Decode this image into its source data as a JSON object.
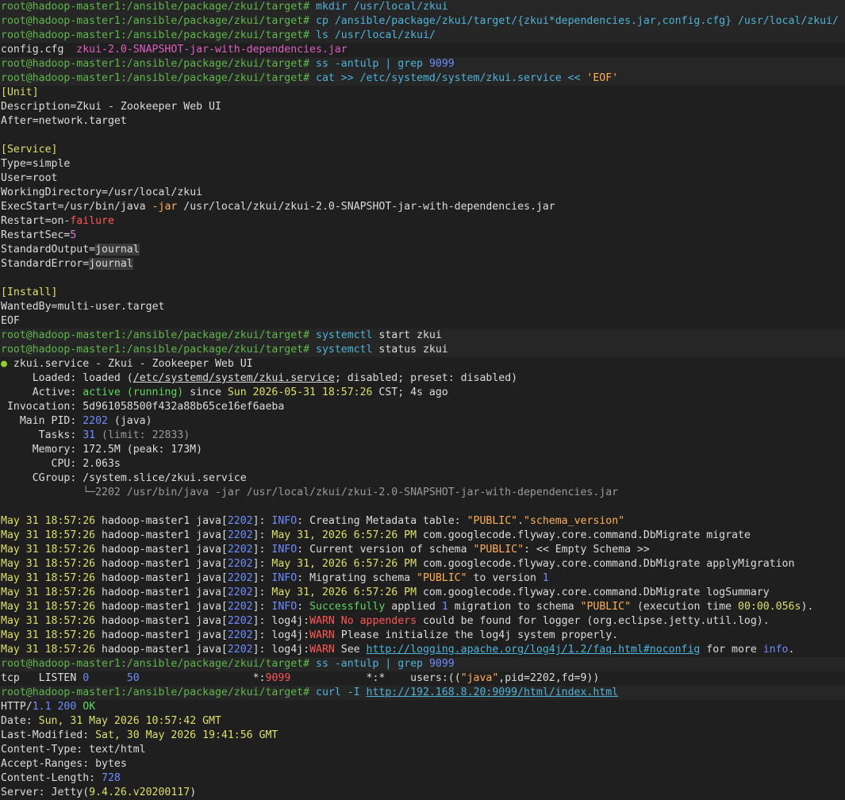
{
  "colors": {
    "background": "#1f1f1f",
    "prompt": "#5fb84a",
    "command": "#4fb3d9",
    "number": "#6f8cff",
    "error": "#ff5555",
    "warn": "#ff5555",
    "string": "#ffae57",
    "date": "#dfdf6a",
    "active": "#8fd12f"
  },
  "lines": [
    {
      "cmd": true,
      "segs": [
        {
          "t": "root@hadoop-master1",
          "c": "c-green"
        },
        {
          "t": ":/ansible/package/zkui/target# ",
          "c": "c-green"
        },
        {
          "t": "mkdir",
          "c": "c-cyan"
        },
        {
          "t": " /usr/local/zkui",
          "c": "c-cyan"
        }
      ]
    },
    {
      "cmd": true,
      "segs": [
        {
          "t": "root@hadoop-master1",
          "c": "c-green"
        },
        {
          "t": ":/ansible/package/zkui/target# ",
          "c": "c-green"
        },
        {
          "t": "cp",
          "c": "c-cyan"
        },
        {
          "t": " /ansible/package/zkui/target/{zkui*dependencies.jar,config.cfg} /usr/local/zkui/",
          "c": "c-cyan"
        }
      ]
    },
    {
      "cmd": true,
      "segs": [
        {
          "t": "root@hadoop-master1",
          "c": "c-green"
        },
        {
          "t": ":/ansible/package/zkui/target# ",
          "c": "c-green"
        },
        {
          "t": "ls",
          "c": "c-cyan"
        },
        {
          "t": " /usr/local/zkui/",
          "c": "c-cyan"
        }
      ]
    },
    {
      "segs": [
        {
          "t": "config.cfg  ",
          "c": "c-white"
        },
        {
          "t": "zkui-2.0-SNAPSHOT-jar-with-dependencies.jar",
          "c": "c-magenta"
        }
      ]
    },
    {
      "cmd": true,
      "segs": [
        {
          "t": "root@hadoop-master1",
          "c": "c-green"
        },
        {
          "t": ":/ansible/package/zkui/target# ",
          "c": "c-green"
        },
        {
          "t": "ss",
          "c": "c-cyan"
        },
        {
          "t": " -antulp | ",
          "c": "c-cyan"
        },
        {
          "t": "grep",
          "c": "c-cyan"
        },
        {
          "t": " 9099",
          "c": "c-blue"
        }
      ]
    },
    {
      "cmd": true,
      "segs": [
        {
          "t": "root@hadoop-master1",
          "c": "c-green"
        },
        {
          "t": ":/ansible/package/zkui/target# ",
          "c": "c-green"
        },
        {
          "t": "cat",
          "c": "c-cyan"
        },
        {
          "t": " >> /etc/systemd/system/zkui.service << ",
          "c": "c-cyan"
        },
        {
          "t": "'EOF'",
          "c": "c-orange"
        }
      ]
    },
    {
      "segs": [
        {
          "t": "[Unit]",
          "c": "c-yellow"
        }
      ]
    },
    {
      "segs": [
        {
          "t": "Description",
          "c": "c-white"
        },
        {
          "t": "=",
          "c": "c-white"
        },
        {
          "t": "Zkui - Zookeeper Web UI",
          "c": "c-white"
        }
      ]
    },
    {
      "segs": [
        {
          "t": "After",
          "c": "c-white"
        },
        {
          "t": "=network.target",
          "c": "c-white"
        }
      ]
    },
    {
      "segs": [
        {
          "t": "",
          "c": "c-white"
        }
      ]
    },
    {
      "segs": [
        {
          "t": "[Service]",
          "c": "c-yellow"
        }
      ]
    },
    {
      "segs": [
        {
          "t": "Type",
          "c": "c-white"
        },
        {
          "t": "=simple",
          "c": "c-white"
        }
      ]
    },
    {
      "segs": [
        {
          "t": "User",
          "c": "c-white"
        },
        {
          "t": "=root",
          "c": "c-white"
        }
      ]
    },
    {
      "segs": [
        {
          "t": "WorkingDirectory",
          "c": "c-white"
        },
        {
          "t": "=/usr/local/zkui",
          "c": "c-white"
        }
      ]
    },
    {
      "segs": [
        {
          "t": "ExecStart",
          "c": "c-white"
        },
        {
          "t": "=/usr/bin/java ",
          "c": "c-white"
        },
        {
          "t": "-jar",
          "c": "c-orange"
        },
        {
          "t": " /usr/local/zkui/zkui-2.0-SNAPSHOT-jar-with-dependencies.jar",
          "c": "c-white"
        }
      ]
    },
    {
      "segs": [
        {
          "t": "Restart",
          "c": "c-white"
        },
        {
          "t": "=on-",
          "c": "c-white"
        },
        {
          "t": "failure",
          "c": "c-red"
        }
      ]
    },
    {
      "segs": [
        {
          "t": "RestartSec",
          "c": "c-white"
        },
        {
          "t": "=",
          "c": "c-white"
        },
        {
          "t": "5",
          "c": "c-pink"
        }
      ]
    },
    {
      "segs": [
        {
          "t": "StandardOutput",
          "c": "c-white"
        },
        {
          "t": "=",
          "c": "c-white"
        },
        {
          "t": "journal",
          "c": "c-white hl"
        }
      ]
    },
    {
      "segs": [
        {
          "t": "StandardError",
          "c": "c-white"
        },
        {
          "t": "=",
          "c": "c-white"
        },
        {
          "t": "journal",
          "c": "c-white hl"
        }
      ]
    },
    {
      "segs": [
        {
          "t": "",
          "c": "c-white"
        }
      ]
    },
    {
      "segs": [
        {
          "t": "[Install]",
          "c": "c-yellow"
        }
      ]
    },
    {
      "segs": [
        {
          "t": "WantedBy",
          "c": "c-white"
        },
        {
          "t": "=multi-user.target",
          "c": "c-white"
        }
      ]
    },
    {
      "segs": [
        {
          "t": "EOF",
          "c": "c-white"
        }
      ]
    },
    {
      "cmd": true,
      "segs": [
        {
          "t": "root@hadoop-master1",
          "c": "c-green"
        },
        {
          "t": ":/ansible/package/zkui/target# ",
          "c": "c-green"
        },
        {
          "t": "systemctl",
          "c": "c-cyan"
        },
        {
          "t": " start zkui",
          "c": "c-white"
        }
      ]
    },
    {
      "cmd": true,
      "segs": [
        {
          "t": "root@hadoop-master1",
          "c": "c-green"
        },
        {
          "t": ":/ansible/package/zkui/target# ",
          "c": "c-green"
        },
        {
          "t": "systemctl",
          "c": "c-cyan"
        },
        {
          "t": " status zkui",
          "c": "c-white"
        }
      ]
    },
    {
      "segs": [
        {
          "t": "●",
          "c": "dot"
        },
        {
          "t": " zkui.service - Zkui - Zookeeper Web UI",
          "c": "c-white"
        }
      ]
    },
    {
      "segs": [
        {
          "t": "     Loaded: ",
          "c": "c-white"
        },
        {
          "t": "loaded (",
          "c": "c-white"
        },
        {
          "t": "/etc/systemd/system/zkui.service",
          "c": "c-white u"
        },
        {
          "t": "; disabled; preset: disabled)",
          "c": "c-white"
        }
      ]
    },
    {
      "segs": [
        {
          "t": "     Active: ",
          "c": "c-white"
        },
        {
          "t": "active (running)",
          "c": "c-ok"
        },
        {
          "t": " since ",
          "c": "c-white"
        },
        {
          "t": "Sun 2026-05-31 18:57:26",
          "c": "c-yellow"
        },
        {
          "t": " CST; 4s ago",
          "c": "c-white"
        }
      ]
    },
    {
      "segs": [
        {
          "t": " Invocation: 5d961058500f432a88b65ce16ef6aeba",
          "c": "c-white"
        }
      ]
    },
    {
      "segs": [
        {
          "t": "   Main PID: ",
          "c": "c-white"
        },
        {
          "t": "2202",
          "c": "c-blue"
        },
        {
          "t": " (java)",
          "c": "c-white"
        }
      ]
    },
    {
      "segs": [
        {
          "t": "      Tasks: ",
          "c": "c-white"
        },
        {
          "t": "31",
          "c": "c-blue"
        },
        {
          "t": " (limit: 22833)",
          "c": "c-grey"
        }
      ]
    },
    {
      "segs": [
        {
          "t": "     Memory: 172.5M (peak: 173M)",
          "c": "c-white"
        }
      ]
    },
    {
      "segs": [
        {
          "t": "        CPU: 2.063s",
          "c": "c-white"
        }
      ]
    },
    {
      "segs": [
        {
          "t": "     CGroup: /system.slice/zkui.service",
          "c": "c-white"
        }
      ]
    },
    {
      "segs": [
        {
          "t": "             └─2202 /usr/bin/java -jar /usr/local/zkui/zkui-2.0-SNAPSHOT-jar-with-dependencies.jar",
          "c": "c-grey"
        }
      ]
    },
    {
      "segs": [
        {
          "t": "",
          "c": "c-white"
        }
      ]
    },
    {
      "segs": [
        {
          "t": "May 31 18:57:26",
          "c": "c-yellow"
        },
        {
          "t": " hadoop-master1 java[",
          "c": "c-white"
        },
        {
          "t": "2202",
          "c": "c-blue"
        },
        {
          "t": "]: ",
          "c": "c-white"
        },
        {
          "t": "INFO",
          "c": "c-blue"
        },
        {
          "t": ": Creating Metadata table: ",
          "c": "c-white"
        },
        {
          "t": "\"PUBLIC\"",
          "c": "c-orange"
        },
        {
          "t": ".",
          "c": "c-white"
        },
        {
          "t": "\"schema_version\"",
          "c": "c-orange"
        }
      ]
    },
    {
      "segs": [
        {
          "t": "May 31 18:57:26",
          "c": "c-yellow"
        },
        {
          "t": " hadoop-master1 java[",
          "c": "c-white"
        },
        {
          "t": "2202",
          "c": "c-blue"
        },
        {
          "t": "]: ",
          "c": "c-white"
        },
        {
          "t": "May 31, 2026 6:57:26 PM",
          "c": "c-yellow"
        },
        {
          "t": " com.googlecode.flyway.core.command.DbMigrate migrate",
          "c": "c-white"
        }
      ]
    },
    {
      "segs": [
        {
          "t": "May 31 18:57:26",
          "c": "c-yellow"
        },
        {
          "t": " hadoop-master1 java[",
          "c": "c-white"
        },
        {
          "t": "2202",
          "c": "c-blue"
        },
        {
          "t": "]: ",
          "c": "c-white"
        },
        {
          "t": "INFO",
          "c": "c-blue"
        },
        {
          "t": ": Current version of schema ",
          "c": "c-white"
        },
        {
          "t": "\"PUBLIC\"",
          "c": "c-orange"
        },
        {
          "t": ": << Empty Schema >>",
          "c": "c-white"
        }
      ]
    },
    {
      "segs": [
        {
          "t": "May 31 18:57:26",
          "c": "c-yellow"
        },
        {
          "t": " hadoop-master1 java[",
          "c": "c-white"
        },
        {
          "t": "2202",
          "c": "c-blue"
        },
        {
          "t": "]: ",
          "c": "c-white"
        },
        {
          "t": "May 31, 2026 6:57:26 PM",
          "c": "c-yellow"
        },
        {
          "t": " com.googlecode.flyway.core.command.DbMigrate applyMigration",
          "c": "c-white"
        }
      ]
    },
    {
      "segs": [
        {
          "t": "May 31 18:57:26",
          "c": "c-yellow"
        },
        {
          "t": " hadoop-master1 java[",
          "c": "c-white"
        },
        {
          "t": "2202",
          "c": "c-blue"
        },
        {
          "t": "]: ",
          "c": "c-white"
        },
        {
          "t": "INFO",
          "c": "c-blue"
        },
        {
          "t": ": Migrating schema ",
          "c": "c-white"
        },
        {
          "t": "\"PUBLIC\"",
          "c": "c-orange"
        },
        {
          "t": " to version ",
          "c": "c-white"
        },
        {
          "t": "1",
          "c": "c-blue"
        }
      ]
    },
    {
      "segs": [
        {
          "t": "May 31 18:57:26",
          "c": "c-yellow"
        },
        {
          "t": " hadoop-master1 java[",
          "c": "c-white"
        },
        {
          "t": "2202",
          "c": "c-blue"
        },
        {
          "t": "]: ",
          "c": "c-white"
        },
        {
          "t": "May 31, 2026 6:57:26 PM",
          "c": "c-yellow"
        },
        {
          "t": " com.googlecode.flyway.core.command.DbMigrate logSummary",
          "c": "c-white"
        }
      ]
    },
    {
      "segs": [
        {
          "t": "May 31 18:57:26",
          "c": "c-yellow"
        },
        {
          "t": " hadoop-master1 java[",
          "c": "c-white"
        },
        {
          "t": "2202",
          "c": "c-blue"
        },
        {
          "t": "]: ",
          "c": "c-white"
        },
        {
          "t": "INFO",
          "c": "c-blue"
        },
        {
          "t": ": ",
          "c": "c-white"
        },
        {
          "t": "Successfully",
          "c": "c-ok"
        },
        {
          "t": " applied ",
          "c": "c-white"
        },
        {
          "t": "1",
          "c": "c-blue"
        },
        {
          "t": " migration to schema ",
          "c": "c-white"
        },
        {
          "t": "\"PUBLIC\"",
          "c": "c-orange"
        },
        {
          "t": " (execution time ",
          "c": "c-white"
        },
        {
          "t": "00:00.056s",
          "c": "c-yellow"
        },
        {
          "t": ").",
          "c": "c-white"
        }
      ]
    },
    {
      "segs": [
        {
          "t": "May 31 18:57:26",
          "c": "c-yellow"
        },
        {
          "t": " hadoop-master1 java[",
          "c": "c-white"
        },
        {
          "t": "2202",
          "c": "c-blue"
        },
        {
          "t": "]: ",
          "c": "c-white"
        },
        {
          "t": "log4j:",
          "c": "c-white"
        },
        {
          "t": "WARN No appenders",
          "c": "c-red"
        },
        {
          "t": " could be found for logger (org.eclipse.jetty.util.log).",
          "c": "c-white"
        }
      ]
    },
    {
      "segs": [
        {
          "t": "May 31 18:57:26",
          "c": "c-yellow"
        },
        {
          "t": " hadoop-master1 java[",
          "c": "c-white"
        },
        {
          "t": "2202",
          "c": "c-blue"
        },
        {
          "t": "]: ",
          "c": "c-white"
        },
        {
          "t": "log4j:",
          "c": "c-white"
        },
        {
          "t": "WARN",
          "c": "c-red"
        },
        {
          "t": " Please initialize the log4j system properly.",
          "c": "c-white"
        }
      ]
    },
    {
      "segs": [
        {
          "t": "May 31 18:57:26",
          "c": "c-yellow"
        },
        {
          "t": " hadoop-master1 java[",
          "c": "c-white"
        },
        {
          "t": "2202",
          "c": "c-blue"
        },
        {
          "t": "]: ",
          "c": "c-white"
        },
        {
          "t": "log4j:",
          "c": "c-white"
        },
        {
          "t": "WARN",
          "c": "c-red"
        },
        {
          "t": " See ",
          "c": "c-white"
        },
        {
          "t": "http://logging.apache.org/log4j/1.2/faq.html#noconfig",
          "c": "c-cyan u"
        },
        {
          "t": " for more ",
          "c": "c-white"
        },
        {
          "t": "info",
          "c": "c-blue"
        },
        {
          "t": ".",
          "c": "c-white"
        }
      ]
    },
    {
      "cmd": true,
      "segs": [
        {
          "t": "root@hadoop-master1",
          "c": "c-green"
        },
        {
          "t": ":/ansible/package/zkui/target# ",
          "c": "c-green"
        },
        {
          "t": "ss",
          "c": "c-cyan"
        },
        {
          "t": " -antulp | ",
          "c": "c-cyan"
        },
        {
          "t": "grep",
          "c": "c-cyan"
        },
        {
          "t": " 9099",
          "c": "c-blue"
        }
      ]
    },
    {
      "segs": [
        {
          "t": "tcp   LISTEN ",
          "c": "c-white"
        },
        {
          "t": "0",
          "c": "c-blue"
        },
        {
          "t": "      ",
          "c": "c-white"
        },
        {
          "t": "50",
          "c": "c-blue"
        },
        {
          "t": "                  *:",
          "c": "c-white"
        },
        {
          "t": "9099",
          "c": "c-red"
        },
        {
          "t": "            *:*    users:((",
          "c": "c-white"
        },
        {
          "t": "\"java\"",
          "c": "c-orange"
        },
        {
          "t": ",pid=2202,fd=9))",
          "c": "c-white"
        }
      ]
    },
    {
      "cmd": true,
      "segs": [
        {
          "t": "root@hadoop-master1",
          "c": "c-green"
        },
        {
          "t": ":/ansible/package/zkui/target# ",
          "c": "c-green"
        },
        {
          "t": "curl",
          "c": "c-cyan"
        },
        {
          "t": " -I ",
          "c": "c-cyan"
        },
        {
          "t": "http://192.168.8.20:9099/html/index.html",
          "c": "c-cyan u"
        }
      ]
    },
    {
      "segs": [
        {
          "t": "HTTP/",
          "c": "c-white"
        },
        {
          "t": "1.1",
          "c": "c-blue"
        },
        {
          "t": " ",
          "c": "c-white"
        },
        {
          "t": "200",
          "c": "c-blue"
        },
        {
          "t": " ",
          "c": "c-white"
        },
        {
          "t": "OK",
          "c": "c-ok"
        }
      ]
    },
    {
      "segs": [
        {
          "t": "Date: ",
          "c": "c-white"
        },
        {
          "t": "Sun, 31 May 2026 10:57:42 GMT",
          "c": "c-yellow"
        }
      ]
    },
    {
      "segs": [
        {
          "t": "Last-Modified: ",
          "c": "c-white"
        },
        {
          "t": "Sat, 30 May 2026 19:41:56 GMT",
          "c": "c-yellow"
        }
      ]
    },
    {
      "segs": [
        {
          "t": "Content-Type: text/html",
          "c": "c-white"
        }
      ]
    },
    {
      "segs": [
        {
          "t": "Accept-Ranges: bytes",
          "c": "c-white"
        }
      ]
    },
    {
      "segs": [
        {
          "t": "Content-Length: ",
          "c": "c-white"
        },
        {
          "t": "728",
          "c": "c-blue"
        }
      ]
    },
    {
      "segs": [
        {
          "t": "Server: Jetty(",
          "c": "c-white"
        },
        {
          "t": "9.4.26.v20200117",
          "c": "c-yellow"
        },
        {
          "t": ")",
          "c": "c-white"
        }
      ]
    }
  ]
}
